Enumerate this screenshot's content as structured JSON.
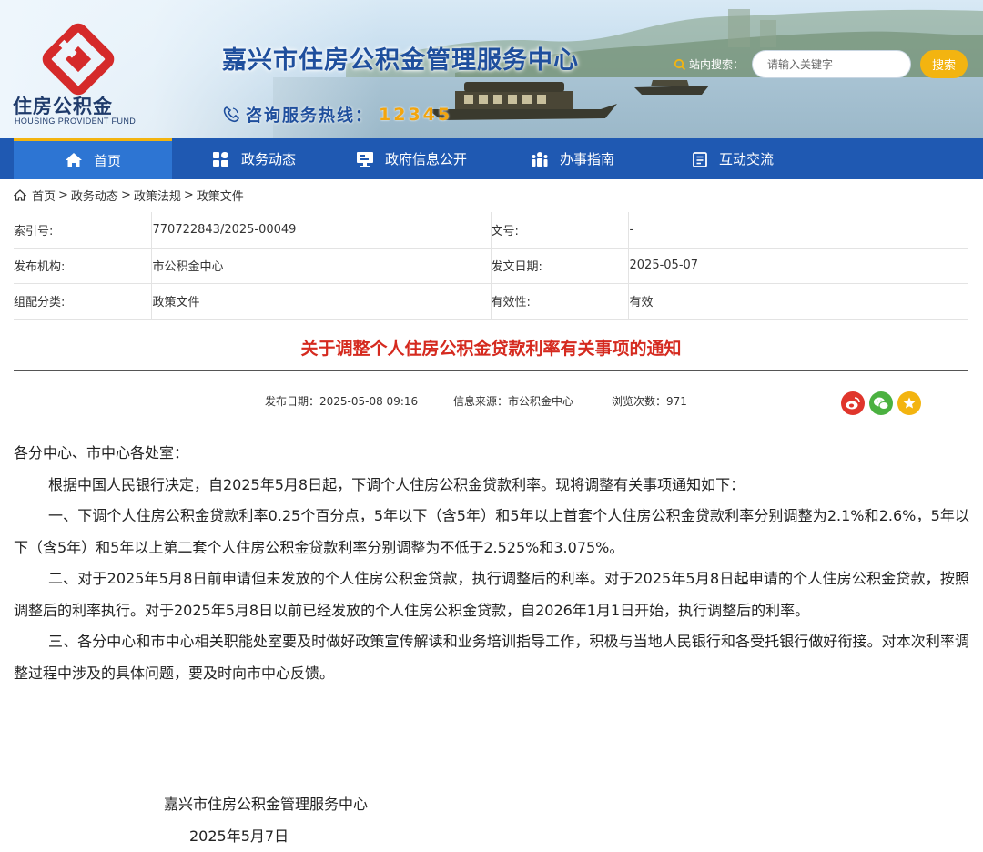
{
  "header": {
    "logo_cn": "住房公积金",
    "logo_en": "HOUSING PROVIDENT FUND",
    "site_title": "嘉兴市住房公积金管理服务中心",
    "hotline_label": "咨询服务热线：",
    "hotline_number": "12345",
    "search_label": "站内搜索：",
    "search_placeholder": "请输入关键字",
    "search_button": "搜索",
    "colors": {
      "title": "#1f4f9d",
      "hotline_number": "#f3a50e",
      "search_button": "#f3b410",
      "logo_red": "#d52a2a"
    }
  },
  "nav": {
    "items": [
      {
        "label": "首页",
        "icon": "home-icon",
        "active": true
      },
      {
        "label": "政务动态",
        "icon": "grid-icon"
      },
      {
        "label": "政府信息公开",
        "icon": "monitor-icon"
      },
      {
        "label": "办事指南",
        "icon": "people-icon"
      },
      {
        "label": "互动交流",
        "icon": "document-icon"
      }
    ],
    "colors": {
      "bar": "#1f59b2",
      "active": "#2d75d3"
    }
  },
  "breadcrumb": {
    "items": [
      "首页",
      "政务动态",
      "政策法规",
      "政策文件"
    ],
    "separator": ">"
  },
  "info": {
    "rows": [
      {
        "k1": "索引号:",
        "v1": "770722843/2025-00049",
        "k2": "文号:",
        "v2": "-"
      },
      {
        "k1": "发布机构:",
        "v1": "市公积金中心",
        "k2": "发文日期:",
        "v2": "2025-05-07"
      },
      {
        "k1": "组配分类:",
        "v1": "政策文件",
        "k2": "有效性:",
        "v2": "有效"
      }
    ]
  },
  "article": {
    "title": "关于调整个人住房公积金贷款利率有关事项的通知",
    "publish_date": "发布日期：2025-05-08 09:16",
    "source": "信息来源：市公积金中心",
    "views": "浏览次数：971",
    "salutation": "各分中心、市中心各处室：",
    "paragraphs": [
      "根据中国人民银行决定，自2025年5月8日起，下调个人住房公积金贷款利率。现将调整有关事项通知如下：",
      "一、下调个人住房公积金贷款利率0.25个百分点，5年以下（含5年）和5年以上首套个人住房公积金贷款利率分别调整为2.1%和2.6%，5年以下（含5年）和5年以上第二套个人住房公积金贷款利率分别调整为不低于2.525%和3.075%。",
      "二、对于2025年5月8日前申请但未发放的个人住房公积金贷款，执行调整后的利率。对于2025年5月8日起申请的个人住房公积金贷款，按照调整后的利率执行。对于2025年5月8日以前已经发放的个人住房公积金贷款，自2026年1月1日开始，执行调整后的利率。",
      "三、各分中心和市中心相关职能处室要及时做好政策宣传解读和业务培训指导工作，积极与当地人民银行和各受托银行做好衔接。对本次利率调整过程中涉及的具体问题，要及时向市中心反馈。"
    ],
    "signature_org": "嘉兴市住房公积金管理服务中心",
    "signature_date": "2025年5月7日",
    "title_color": "#d52a1f"
  },
  "share": {
    "icons": [
      "weibo-icon",
      "wechat-icon",
      "favorite-icon"
    ],
    "colors": [
      "#e0362c",
      "#4bb140",
      "#f3b410"
    ]
  }
}
